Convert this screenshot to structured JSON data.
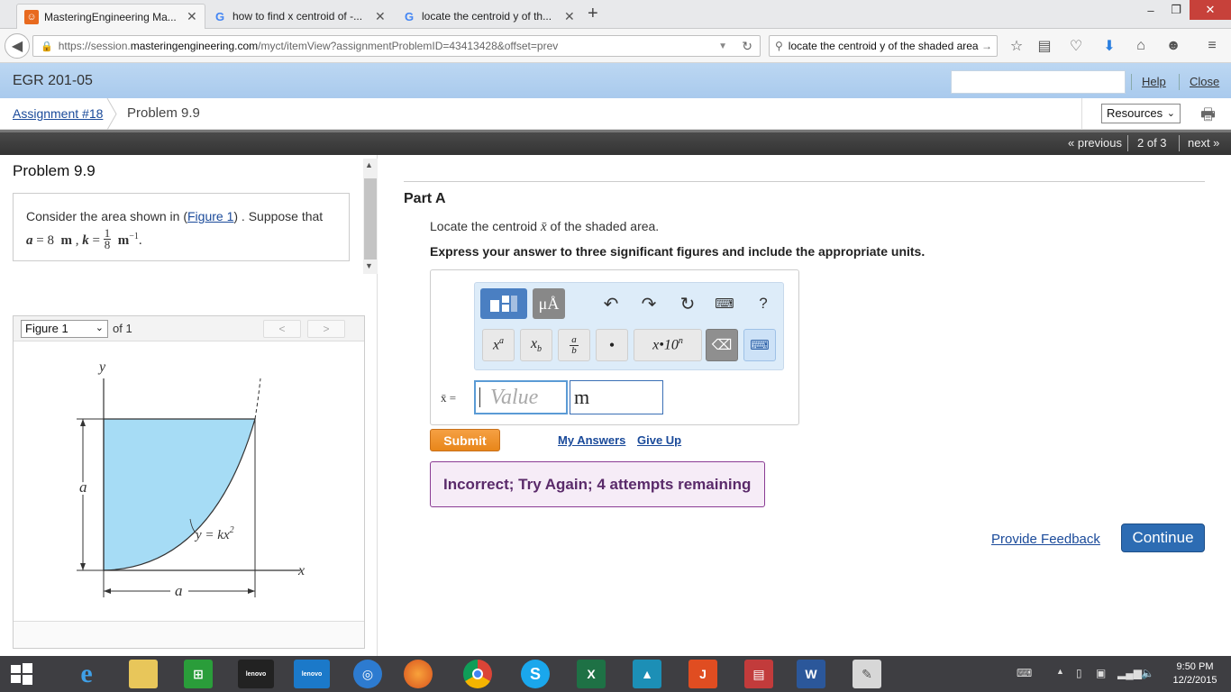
{
  "browser": {
    "tabs": [
      {
        "label": "MasteringEngineering Ma...",
        "active": true
      },
      {
        "label": "how to find x centroid of -...",
        "active": false
      },
      {
        "label": "locate the centroid y of th...",
        "active": false
      }
    ],
    "url_prefix": "https://session.",
    "url_host": "masteringengineering.com",
    "url_path": "/myct/itemView?assignmentProblemID=43413428&offset=prev",
    "search_text": "locate the centroid y of the shaded area"
  },
  "header": {
    "course": "EGR 201-05",
    "help": "Help",
    "close": "Close"
  },
  "breadcrumb": {
    "assignment": "Assignment #18",
    "problem": "Problem 9.9",
    "resources": "Resources"
  },
  "pager": {
    "previous": "« previous",
    "position": "2 of 3",
    "next": "next »"
  },
  "problem": {
    "title": "Problem 9.9",
    "text_before": "Consider the area shown in (",
    "figure_link": "Figure 1",
    "text_after": ") . Suppose that",
    "a_label": "a",
    "a_value": "8",
    "a_unit": "m",
    "k_label": "k",
    "k_num": "1",
    "k_den": "8",
    "k_unit": "m",
    "k_exp": "−1"
  },
  "figure": {
    "select": "Figure 1",
    "of": "of 1",
    "prev": "<",
    "next": ">",
    "y_axis": "y",
    "x_axis": "x",
    "dim_a_vertical": "a",
    "dim_a_horizontal": "a",
    "curve_label": "y = kx",
    "curve_exp": "2",
    "fill_color": "#a6dcf5"
  },
  "part": {
    "title": "Part A",
    "question_before": "Locate the centroid ",
    "question_symbol": "x̄",
    "question_after": " of the shaded area.",
    "instruction": "Express your answer to three significant figures and include the appropriate units.",
    "answer_label": "x̄ =",
    "value_placeholder": "Value",
    "unit_value": "m",
    "toolbar": {
      "templates_icon": "templates-icon",
      "units_label": "μÅ",
      "keys": [
        "xa",
        "xb",
        "a/b",
        "•",
        "x•10n"
      ]
    },
    "submit": "Submit",
    "my_answers": "My Answers",
    "give_up": "Give Up",
    "feedback_message": "Incorrect; Try Again; 4 attempts remaining",
    "provide_feedback": "Provide Feedback",
    "continue": "Continue"
  },
  "taskbar": {
    "time": "9:50 PM",
    "date": "12/2/2015"
  }
}
